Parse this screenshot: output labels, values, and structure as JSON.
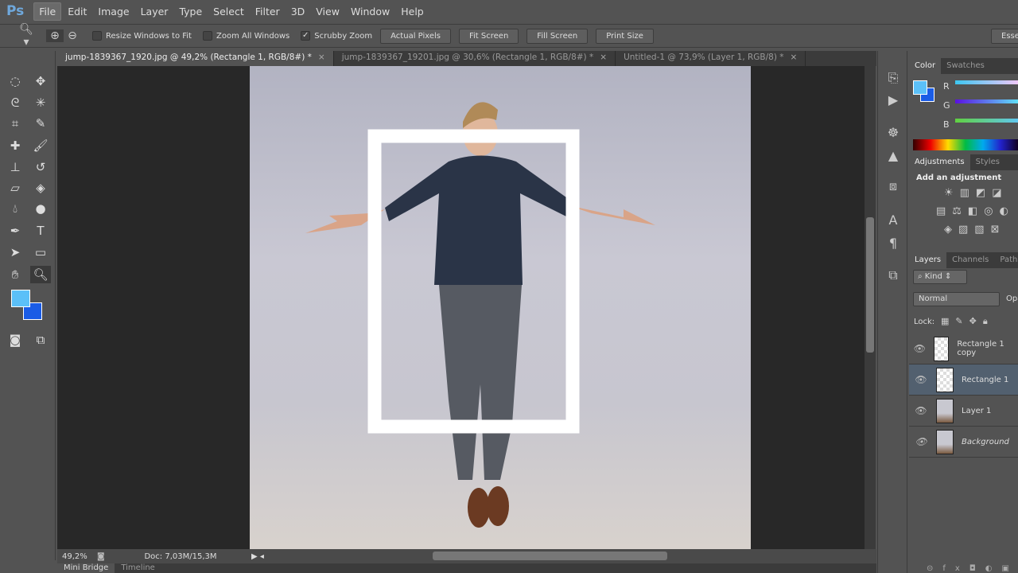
{
  "app": {
    "logo": "Ps"
  },
  "menu": [
    "File",
    "Edit",
    "Image",
    "Layer",
    "Type",
    "Select",
    "Filter",
    "3D",
    "View",
    "Window",
    "Help"
  ],
  "options": {
    "resize_windows": "Resize Windows to Fit",
    "zoom_all": "Zoom All Windows",
    "scrubby": "Scrubby Zoom",
    "resize_checked": false,
    "zoom_all_checked": false,
    "scrubby_checked": true,
    "actual_pixels": "Actual Pixels",
    "fit_screen": "Fit Screen",
    "fill_screen": "Fill Screen",
    "print_size": "Print Size",
    "workspace": "Essentials"
  },
  "tabs": [
    {
      "label": "jump-1839367_1920.jpg @ 49,2% (Rectangle 1, RGB/8#) *",
      "close": "×"
    },
    {
      "label": "jump-1839367_19201.jpg @ 30,6% (Rectangle 1, RGB/8#) *",
      "close": "×"
    },
    {
      "label": "Untitled-1 @ 73,9% (Layer 1, RGB/8) *",
      "close": "×"
    }
  ],
  "colors": {
    "foreground": "#5bc0f8",
    "background": "#1a5ce6"
  },
  "status": {
    "zoom": "49,2%",
    "doc": "Doc: 7,03M/15,3M"
  },
  "bottom_tabs": [
    "Mini Bridge",
    "Timeline"
  ],
  "color_panel": {
    "tabs": [
      "Color",
      "Swatches"
    ],
    "channels": [
      "R",
      "G",
      "B"
    ]
  },
  "adjustments": {
    "tabs": [
      "Adjustments",
      "Styles"
    ],
    "title": "Add an adjustment"
  },
  "layers_panel": {
    "tabs": [
      "Layers",
      "Channels",
      "Paths"
    ],
    "filter": "Kind",
    "blend_mode": "Normal",
    "opacity_label": "Opa",
    "lock_label": "Lock:",
    "layers": [
      {
        "name": "Rectangle 1 copy",
        "selected": false
      },
      {
        "name": "Rectangle 1",
        "selected": true
      },
      {
        "name": "Layer 1",
        "selected": false
      },
      {
        "name": "Background",
        "selected": false
      }
    ]
  }
}
